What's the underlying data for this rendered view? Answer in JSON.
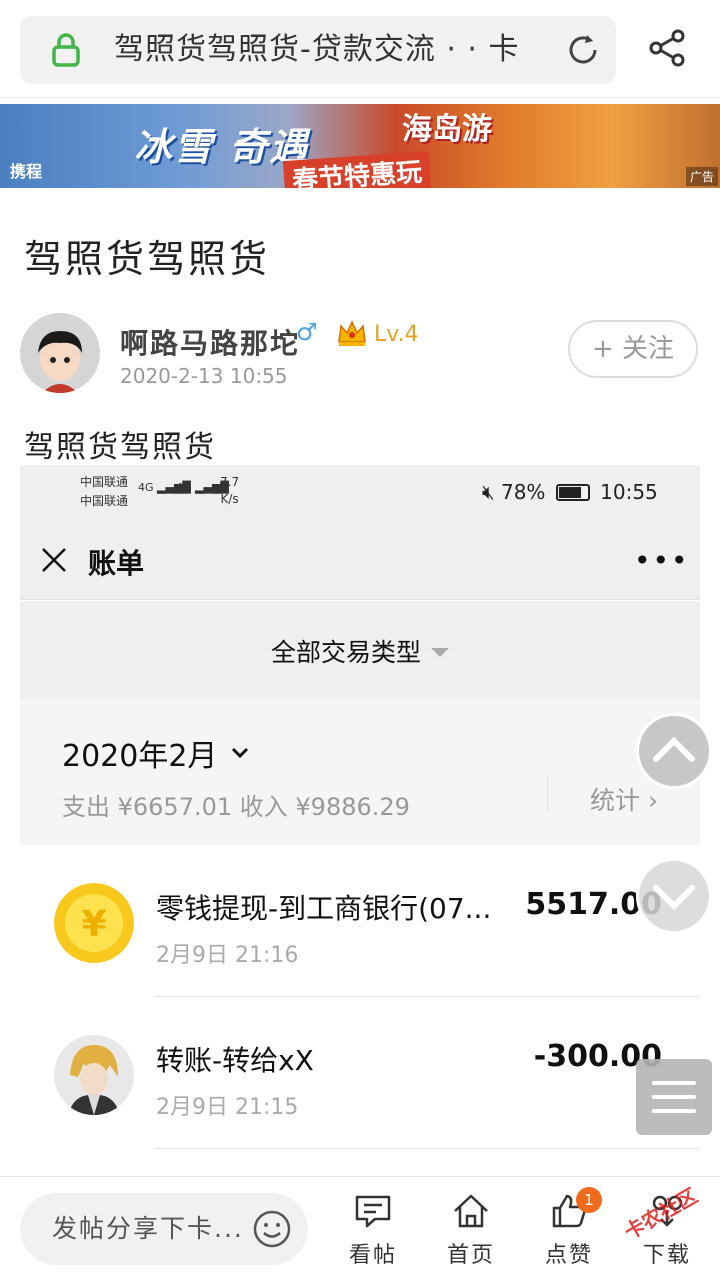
{
  "browser": {
    "url_title": "驾照货驾照货-贷款交流 · · 卡",
    "icons": [
      "lock-icon",
      "reload-icon",
      "share-icon"
    ]
  },
  "ad": {
    "logo": "携程",
    "line1": "冰雪 奇遇",
    "line2": "海岛游",
    "promo": "春节特惠玩",
    "tag": "广告"
  },
  "post": {
    "title": "驾照货驾照货",
    "body": "驾照货驾照货"
  },
  "author": {
    "name": "啊路马路那坨",
    "gender": "♂",
    "level": "Lv.4",
    "time": "2020-2-13 10:55",
    "follow_label": "+ 关注"
  },
  "screenshot": {
    "status": {
      "carrier1": "中国联通",
      "carrier2": "中国联通",
      "net1": "4G",
      "net2": "4G",
      "speed": "7.7",
      "speed_unit": "K/s",
      "battery": "78%",
      "time": "10:55"
    },
    "header_title": "账单",
    "filter_label": "全部交易类型",
    "month": "2020年2月",
    "summary": "支出 ¥6657.01 收入 ¥9886.29",
    "stats_label": "统计",
    "transactions": [
      {
        "title": "零钱提现-到工商银行(07...",
        "time": "2月9日 21:16",
        "amount": "5517.00",
        "icon": "yuan-coin-icon"
      },
      {
        "title": "转账-转给xX",
        "time": "2月9日 21:15",
        "amount": "-300.00",
        "icon": "user-avatar"
      }
    ]
  },
  "bottom_bar": {
    "comment_placeholder": "发帖分享下卡...",
    "nav": [
      {
        "label": "看帖",
        "icon": "comment-icon"
      },
      {
        "label": "首页",
        "icon": "home-icon"
      },
      {
        "label": "点赞",
        "icon": "thumb-up-icon",
        "badge": "1"
      },
      {
        "label": "下载",
        "icon": "download-icon"
      }
    ]
  },
  "watermark": "卡农社区",
  "colors": {
    "accent_green": "#4caf50",
    "level_gold": "#e6a020",
    "badge_orange": "#f26a1b",
    "coin_yellow": "#f8c91c"
  }
}
